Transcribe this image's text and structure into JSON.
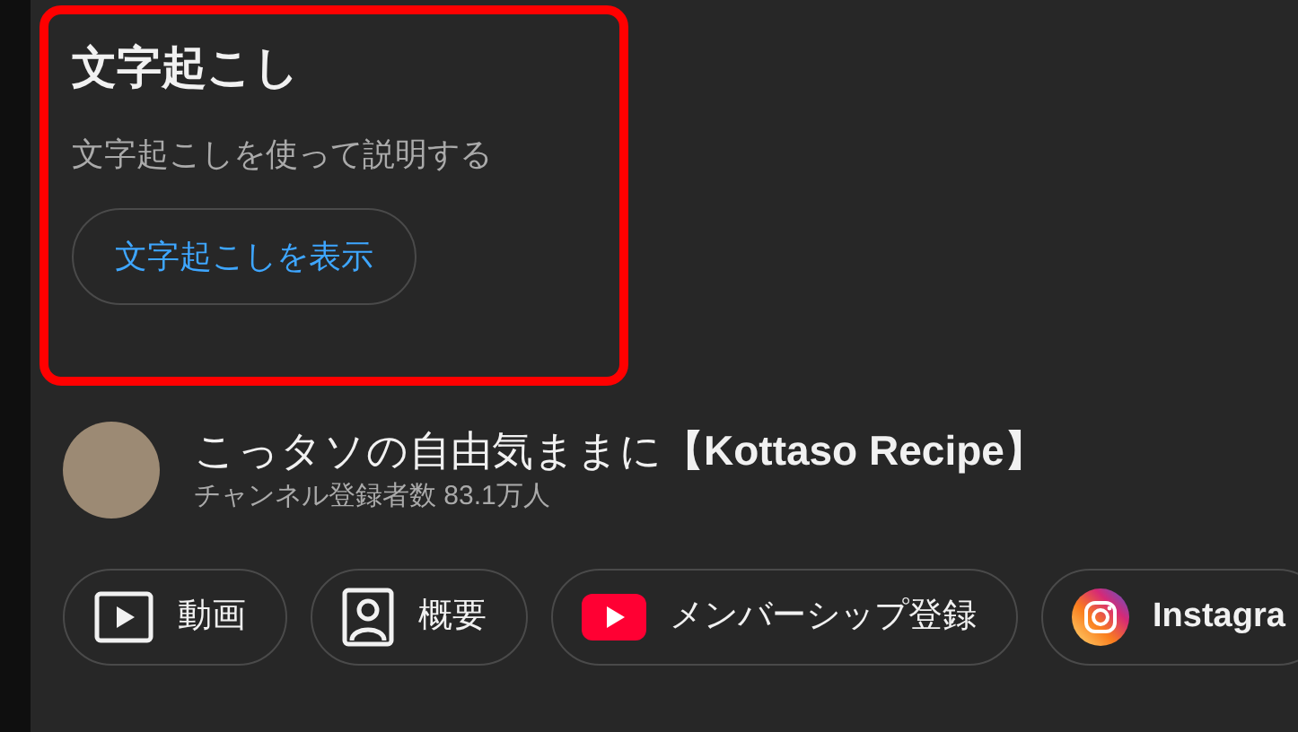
{
  "transcript": {
    "title": "文字起こし",
    "description": "文字起こしを使って説明する",
    "button": "文字起こしを表示"
  },
  "channel": {
    "name": "こっタソの自由気ままに**【Kottaso Recipe】**",
    "subscribers": "チャンネル登録者数 83.1万人"
  },
  "links": [
    {
      "kind": "videos",
      "label": "動画"
    },
    {
      "kind": "about",
      "label": "概要"
    },
    {
      "kind": "membership",
      "label": "メンバーシップ登録"
    },
    {
      "kind": "instagram",
      "label": "Instagra"
    }
  ]
}
